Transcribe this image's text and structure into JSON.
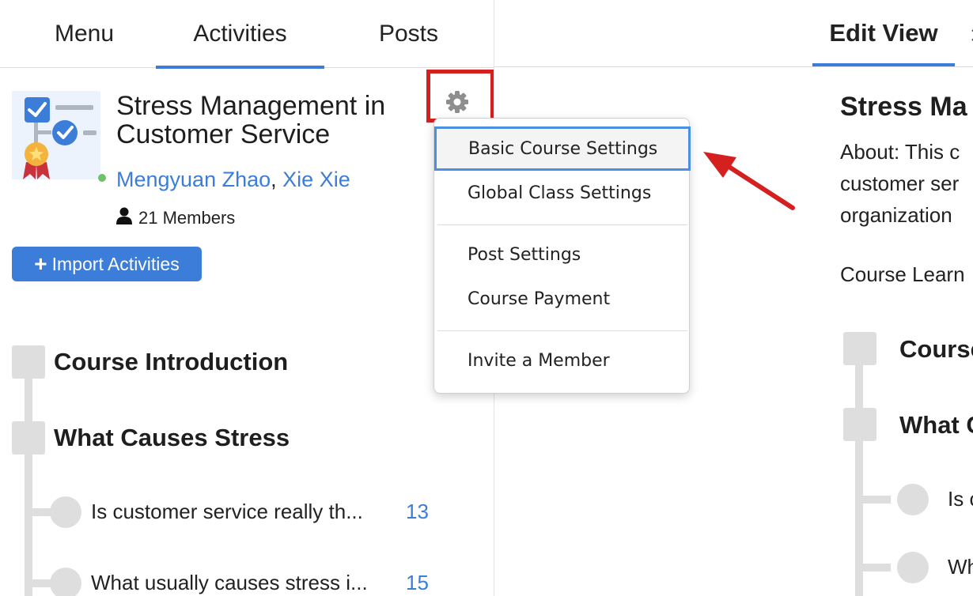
{
  "left_tabs": [
    {
      "label": "Menu",
      "active": false
    },
    {
      "label": "Activities",
      "active": true
    },
    {
      "label": "Posts",
      "active": false
    }
  ],
  "course": {
    "title_line1": "Stress Management in",
    "title_line2": "Customer Service",
    "instructors": [
      "Mengyuan Zhao",
      "Xie Xie"
    ],
    "instructor_separator": ",",
    "members": "21 Members"
  },
  "import_button": {
    "label": "Import Activities"
  },
  "timeline": {
    "sections": [
      {
        "title": "Course Introduction"
      },
      {
        "title": "What Causes Stress"
      }
    ],
    "items": [
      {
        "text": "Is customer service really th...",
        "count": "13"
      },
      {
        "text": "What usually causes stress i...",
        "count": "15"
      }
    ]
  },
  "settings_menu": {
    "items": [
      {
        "label": "Basic Course Settings",
        "selected": true
      },
      {
        "label": "Global Class Settings",
        "selected": false
      },
      {
        "label": "Post Settings",
        "selected": false
      },
      {
        "label": "Course Payment",
        "selected": false
      },
      {
        "label": "Invite a Member",
        "selected": false
      }
    ]
  },
  "right_pane": {
    "tab_label": "Edit View",
    "close_glyph": "✕",
    "title": "Stress Ma",
    "about_lines": [
      "About: This c",
      "customer ser",
      "organization "
    ],
    "learning": "Course Learn",
    "section_1": "Course",
    "section_2": "What C",
    "item_1": "Is c",
    "item_2": "Wh"
  },
  "colors": {
    "accent": "#3b7dd8",
    "highlight_box": "#d52020",
    "selected_border": "#4a90e2",
    "online": "#6ec36a",
    "timeline": "#dedede"
  },
  "icons": {
    "course_thumbnail": "checklist-certificate-icon",
    "settings": "gear-icon",
    "members": "person-icon",
    "import": "plus-icon",
    "annotation": "red-arrow-icon"
  }
}
